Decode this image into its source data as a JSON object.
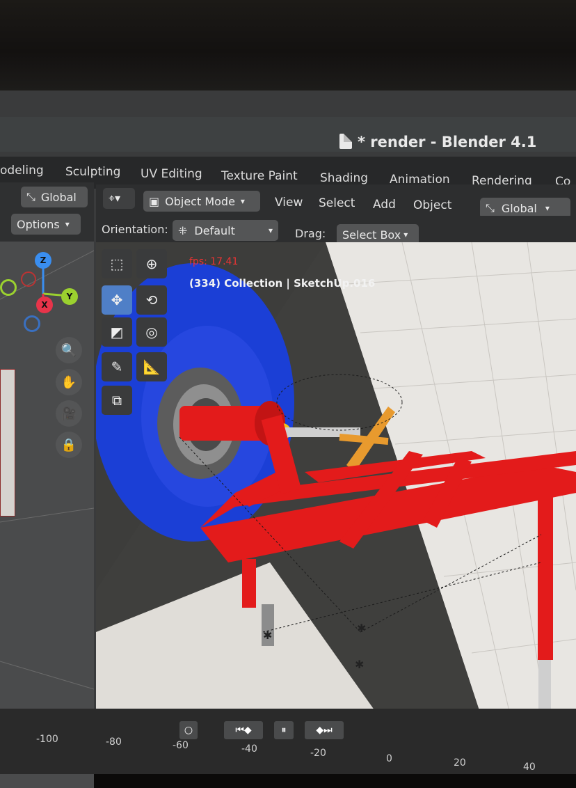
{
  "window": {
    "title": "* render - Blender 4.1"
  },
  "workspaces": [
    "odeling",
    "Sculpting",
    "UV Editing",
    "Texture Paint",
    "Shading",
    "Animation",
    "Rendering",
    "Co"
  ],
  "left_panel": {
    "transform_label": "Global",
    "options_label": "Options",
    "axes": {
      "z": "Z",
      "y": "Y",
      "x": "X"
    }
  },
  "viewport_header": {
    "mode": "Object Mode",
    "menus": [
      "View",
      "Select",
      "Add",
      "Object"
    ],
    "transform": "Global",
    "orientation_label": "Orientation:",
    "orientation_value": "Default",
    "drag_label": "Drag:",
    "drag_value": "Select Box"
  },
  "overlay": {
    "fps": "fps: 17.41",
    "collection": "(334) Collection | SketchUp.016"
  },
  "tools": [
    "select-box-icon",
    "cursor-icon",
    "move-icon",
    "rotate-icon",
    "scale-icon",
    "transform-icon",
    "annotate-icon",
    "measure-icon",
    "add-cube-icon"
  ],
  "timeline": {
    "ticks": [
      "-100",
      "-80",
      "-60",
      "-40",
      "-20",
      "0",
      "20",
      "40"
    ]
  },
  "colors": {
    "accent": "#4f7fc7",
    "fps": "#ee3333",
    "frame": "#e31b1b",
    "wheel": "#1b3fd6"
  }
}
